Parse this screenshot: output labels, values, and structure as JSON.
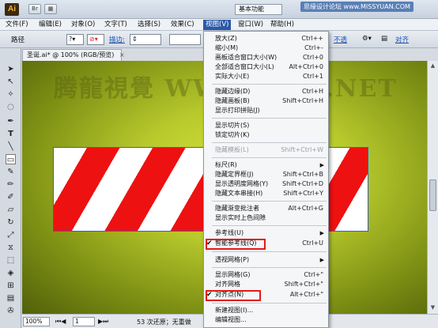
{
  "titlebar": {
    "app_logo": "Ai",
    "workspace": "基本功能",
    "watermark": "思缘设计论坛 www.MISSYUAN.COM"
  },
  "menubar": {
    "items": [
      "文件(F)",
      "编辑(E)",
      "对象(O)",
      "文字(T)",
      "选择(S)",
      "效果(C)",
      "视图(V)",
      "窗口(W)",
      "帮助(H)"
    ],
    "active": "视图(V)"
  },
  "controlbar": {
    "label_path": "路径",
    "stroke_label": "描边:",
    "link_opacity": "不透",
    "link_align": "对齐"
  },
  "document": {
    "tab_title": "圣诞.ai* @ 100% (RGB/预览)",
    "tab_close": "×",
    "canvas_watermark": "腾龍視覺 WWW.TTLY.NET"
  },
  "statusbar": {
    "zoom": "100%",
    "page": "1",
    "status_text": "53 次还原；无重做"
  },
  "menu": {
    "zoom_in": {
      "label": "放大(Z)",
      "shortcut": "Ctrl++"
    },
    "zoom_out": {
      "label": "缩小(M)",
      "shortcut": "Ctrl+-"
    },
    "fit_artboard": {
      "label": "画板适合窗口大小(W)",
      "shortcut": "Ctrl+0"
    },
    "fit_all": {
      "label": "全部适合窗口大小(L)",
      "shortcut": "Alt+Ctrl+0"
    },
    "actual_size": {
      "label": "实际大小(E)",
      "shortcut": "Ctrl+1"
    },
    "hide_edges": {
      "label": "隐藏边缘(D)",
      "shortcut": "Ctrl+H"
    },
    "hide_artboards": {
      "label": "隐藏画板(B)",
      "shortcut": "Shift+Ctrl+H"
    },
    "show_print_tiling": {
      "label": "显示打印拼贴(J)",
      "shortcut": ""
    },
    "show_slices": {
      "label": "显示切片(S)",
      "shortcut": ""
    },
    "lock_slices": {
      "label": "锁定切片(K)",
      "shortcut": ""
    },
    "hide_template": {
      "label": "隐藏模板(L)",
      "shortcut": "Shift+Ctrl+W"
    },
    "rulers": {
      "label": "标尺(R)",
      "shortcut": ""
    },
    "hide_bounding_box": {
      "label": "隐藏定界框(J)",
      "shortcut": "Shift+Ctrl+B"
    },
    "show_transparency_grid": {
      "label": "显示透明度网格(Y)",
      "shortcut": "Shift+Ctrl+D"
    },
    "hide_text_threads": {
      "label": "隐藏文本串接(H)",
      "shortcut": "Shift+Ctrl+Y"
    },
    "hide_gradient_annotator": {
      "label": "隐藏渐变批注者",
      "shortcut": "Alt+Ctrl+G"
    },
    "show_live_paint_gaps": {
      "label": "显示实时上色间隙",
      "shortcut": ""
    },
    "guides": {
      "label": "参考线(U)",
      "shortcut": ""
    },
    "smart_guides": {
      "label": "智能参考线(Q)",
      "shortcut": "Ctrl+U",
      "checked": true
    },
    "perspective_grid": {
      "label": "透视网格(P)",
      "shortcut": ""
    },
    "show_grid": {
      "label": "显示网格(G)",
      "shortcut": "Ctrl+\""
    },
    "snap_to_grid": {
      "label": "对齐网格",
      "shortcut": "Shift+Ctrl+\""
    },
    "snap_to_point": {
      "label": "对齐点(N)",
      "shortcut": "Alt+Ctrl+\"",
      "checked": true
    },
    "new_view": {
      "label": "新建视图(I)...",
      "shortcut": ""
    },
    "edit_views": {
      "label": "编辑视图...",
      "shortcut": ""
    },
    "check_mark": "✔",
    "submenu_arrow": "▶"
  },
  "colors": {
    "stripe_red": "#ee1111",
    "stripe_white": "#ffffff",
    "highlight": "#e11b1b",
    "menu_active": "#2b58a8"
  }
}
